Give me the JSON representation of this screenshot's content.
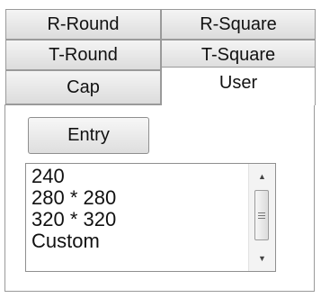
{
  "tabs": {
    "row1": [
      "R-Round",
      "R-Square"
    ],
    "row2": [
      "T-Round",
      "T-Square"
    ],
    "row3": [
      "Cap",
      "User"
    ],
    "selected": "User"
  },
  "panel": {
    "entry_button_label": "Entry",
    "list": {
      "items": [
        "240",
        "280 * 280",
        "320 * 320",
        "Custom"
      ]
    },
    "scrollbar": {
      "up_arrow": "▲",
      "down_arrow": "▼"
    }
  }
}
